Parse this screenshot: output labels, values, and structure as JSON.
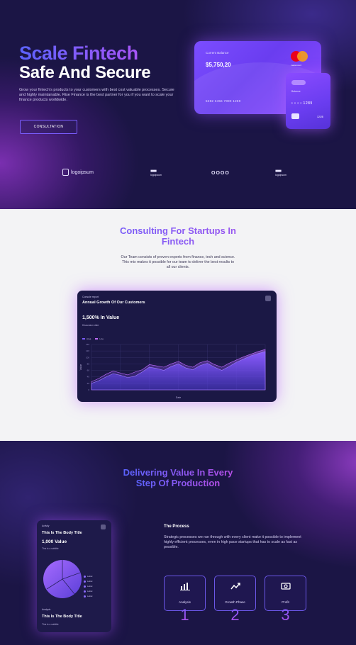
{
  "hero": {
    "title_line1": "Scale Fintech",
    "title_line2": "Safe And Secure",
    "description": "Grow your fintech's products to your customers with best cost valuable processes. Secure and highly maintainable. Rise Finance is the best partner for you if you want to scale your finance products worldwide.",
    "button_label": "CONSULTATION"
  },
  "card_big": {
    "label": "Current Balance",
    "amount": "$5,750,20",
    "number": "5282 3456 7890 1289",
    "brand": "mastercard"
  },
  "card_small": {
    "label": "Balance",
    "dots": "• • • •  1289",
    "expiry": "12/28"
  },
  "logos": {
    "logo1": "logoipsum",
    "logo2_sub": "logoipsum",
    "logo3": "OOOO",
    "logo4_sub": "logoipsum"
  },
  "consulting": {
    "title_part1": "Consulting For Startups In",
    "title_part2": "Fintech",
    "description": "Our Team consists of proven experts from finance, tech and science. This mix makes it possible for our team to deliver the best results to all our clients."
  },
  "tablet": {
    "small_label": "Console report",
    "title": "Annual Growth Of Our Customers",
    "value": "1,500% In Value",
    "sub": "Discussion date",
    "legend": [
      "Area",
      "Line"
    ]
  },
  "chart_data": {
    "type": "area",
    "x": [
      0,
      1,
      2,
      3,
      4,
      5,
      6,
      7,
      8,
      9,
      10,
      11,
      12,
      13,
      14,
      15,
      16,
      17,
      18,
      19,
      20,
      21,
      22,
      23,
      24
    ],
    "series": [
      {
        "name": "Area",
        "values": [
          20,
          28,
          40,
          50,
          45,
          38,
          42,
          55,
          70,
          66,
          60,
          72,
          80,
          68,
          62,
          75,
          82,
          70,
          60,
          72,
          85,
          95,
          105,
          112,
          118
        ]
      },
      {
        "name": "Line",
        "values": [
          25,
          35,
          48,
          58,
          52,
          46,
          55,
          62,
          78,
          74,
          70,
          80,
          88,
          76,
          70,
          84,
          90,
          78,
          70,
          82,
          92,
          102,
          110,
          118,
          125
        ]
      }
    ],
    "xlabel": "Date",
    "ylabel": "Value",
    "ylim": [
      0,
      140
    ],
    "grid": true
  },
  "value_section": {
    "title_line1": "Delivering Value In Every",
    "title_line2": "Step Of Production"
  },
  "phone": {
    "small_label": "Activity",
    "title": "This Is The Body Title",
    "value": "1,000 Value",
    "sub": "This is a subtitle",
    "legend": [
      "Label",
      "Label",
      "Label",
      "Label",
      "Label"
    ],
    "small_label2": "Analysis",
    "title2": "This Is The Body Title",
    "sub2": "This is a subtitle"
  },
  "process": {
    "heading": "The Process",
    "description": "Strategic processes we run through with every client make it possible to implement highly efficient processes, even in high pace startups that has to scale as fast as possible.",
    "steps": [
      {
        "label": "Analysis",
        "icon": "bar-chart-icon",
        "number": "1"
      },
      {
        "label": "Growth Phase",
        "icon": "trend-up-icon",
        "number": "2"
      },
      {
        "label": "Profit",
        "icon": "money-icon",
        "number": "3"
      }
    ]
  },
  "colors": {
    "accent_blue": "#5b63ff",
    "accent_purple": "#a855f7",
    "dark_bg": "#1b1545",
    "light_bg": "#f3f3f5"
  }
}
